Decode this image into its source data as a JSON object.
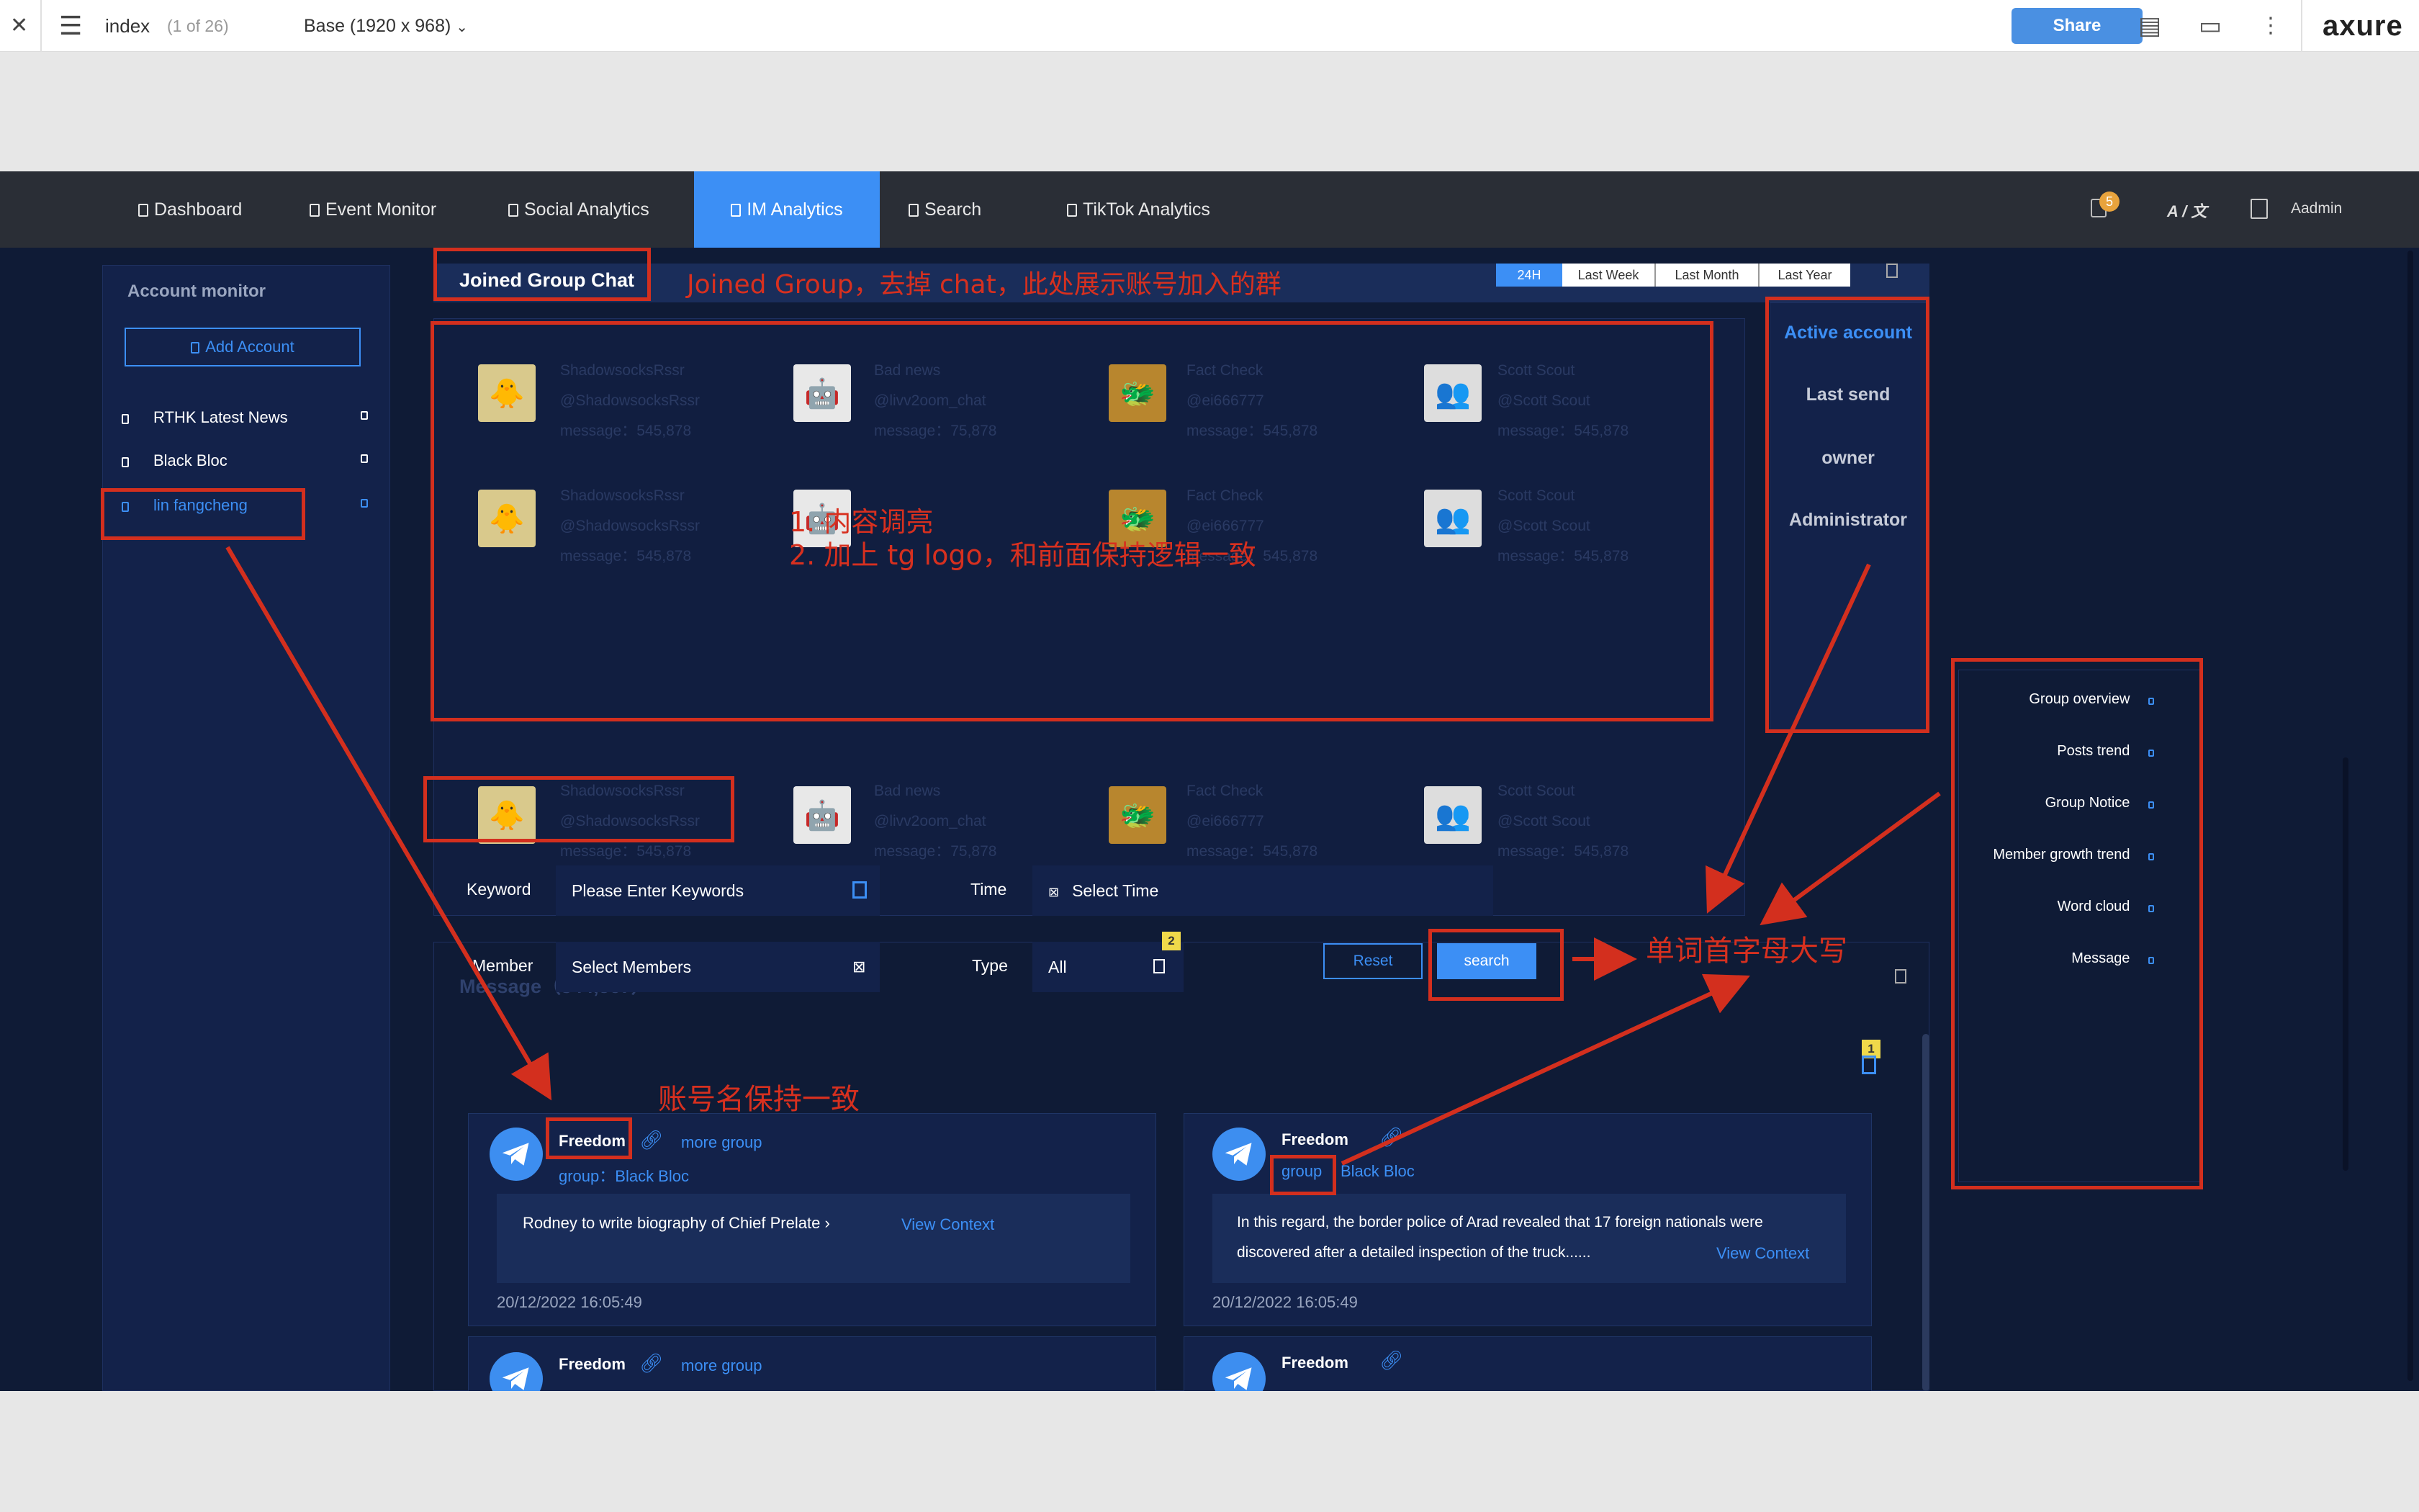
{
  "topbar": {
    "page": "index",
    "page_count": "(1 of 26)",
    "view": "Base (1920 x 968)",
    "share": "Share",
    "logo": "axure"
  },
  "nav": {
    "items": [
      "Dashboard",
      "Event Monitor",
      "Social Analytics",
      "IM Analytics",
      "Search",
      "TikTok Analytics"
    ],
    "active": "IM Analytics",
    "badge": "5",
    "lang": "A / 文",
    "user": "Aadmin"
  },
  "sidebar": {
    "title": "Account monitor",
    "add": "Add Account",
    "accounts": [
      "RTHK Latest News",
      "Black Bloc",
      "lin fangcheng"
    ]
  },
  "joined": {
    "title": "Joined Group Chat",
    "ranges": [
      "24H",
      "Last Week",
      "Last Month",
      "Last Year"
    ],
    "groups": [
      {
        "name": "ShadowsocksRssr",
        "handle": "@ShadowsocksRssr",
        "msg": "message：545,878"
      },
      {
        "name": "Bad news",
        "handle": "@livv2oom_chat",
        "msg": "message：75,878"
      },
      {
        "name": "Fact Check",
        "handle": "@ei666777",
        "msg": "message：545,878"
      },
      {
        "name": "Scott Scout",
        "handle": "@Scott Scout",
        "msg": "message：545,878"
      }
    ]
  },
  "filters": {
    "items": [
      "Active account",
      "Last send",
      "owner",
      "Administrator"
    ]
  },
  "right_menu": {
    "items": [
      "Group overview",
      "Posts trend",
      "Group Notice",
      "Member growth trend",
      "Word cloud",
      "Message"
    ]
  },
  "message": {
    "title": "Message（344,567）",
    "keyword_label": "Keyword",
    "keyword_placeholder": "Please Enter Keywords",
    "time_label": "Time",
    "time_placeholder": "Select Time",
    "member_label": "Member",
    "member_placeholder": "Select Members",
    "type_label": "Type",
    "type_value": "All",
    "badge2": "2",
    "badge1": "1",
    "reset": "Reset",
    "search": "search"
  },
  "posts": [
    {
      "name": "Freedom",
      "more": "more group",
      "group": "group：Black Bloc",
      "text": "Rodney to write biography of Chief Prelate ›",
      "view": "View Context",
      "time": "20/12/2022 16:05:49"
    },
    {
      "name": "Freedom",
      "group_word": "group",
      "group_name": "Black Bloc",
      "text1": "In this regard, the border police of Arad revealed that 17 foreign nationals were",
      "text2": "discovered after a detailed inspection of the truck......",
      "view": "View Context",
      "time": "20/12/2022 16:05:49"
    },
    {
      "name": "Freedom",
      "more": "more group"
    },
    {
      "name": "Freedom"
    }
  ],
  "annotations": {
    "a1": "Joined Group，去掉 chat，此处展示账号加入的群",
    "a2": "1. 内容调亮",
    "a3": "2. 加上 tg logo，和前面保持逻辑一致",
    "a4": "单词首字母大写",
    "a5": "账号名保持一致"
  }
}
